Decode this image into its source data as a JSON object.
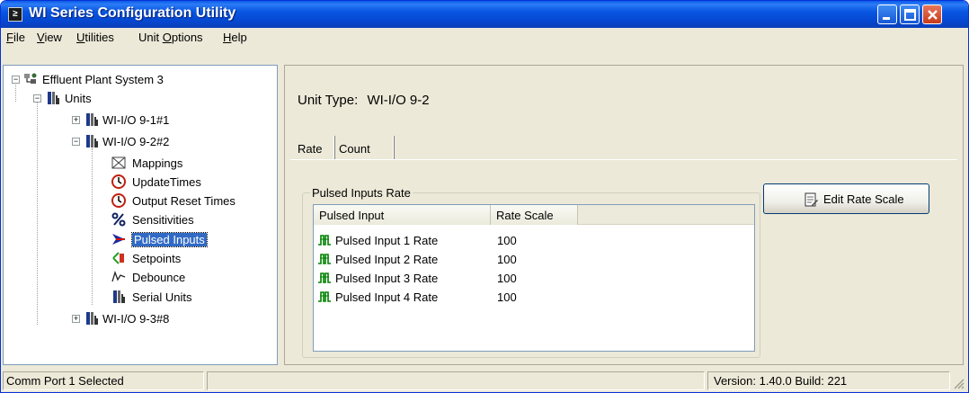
{
  "window": {
    "title": "WI Series Configuration Utility",
    "app_icon_glyph": "≥",
    "title_bar_color": "#0a5ae8",
    "close_button_color": "#d8552f"
  },
  "menu": [
    {
      "label": "File",
      "accel": "F"
    },
    {
      "label": "View",
      "accel": "V"
    },
    {
      "label": "Utilities",
      "accel": "U"
    },
    {
      "label": "Unit Options",
      "accel": "O"
    },
    {
      "label": "Help",
      "accel": "H"
    }
  ],
  "tree": {
    "root": {
      "label": "Effluent Plant System 3",
      "icon": "network-icon",
      "expanded": true
    },
    "units": {
      "label": "Units",
      "icon": "unit-icon",
      "expanded": true
    },
    "unit_1": {
      "label": "WI-I/O 9-1#1",
      "icon": "unit-icon",
      "expanded": false
    },
    "unit_2": {
      "label": "WI-I/O 9-2#2",
      "icon": "unit-icon",
      "expanded": true
    },
    "children": [
      {
        "label": "Mappings",
        "icon": "mappings-icon"
      },
      {
        "label": "UpdateTimes",
        "icon": "clock-icon"
      },
      {
        "label": "Output Reset Times",
        "icon": "clock-icon"
      },
      {
        "label": "Sensitivities",
        "icon": "percent-icon"
      },
      {
        "label": "Pulsed Inputs",
        "icon": "arrow-icon",
        "selected": true
      },
      {
        "label": "Setpoints",
        "icon": "setpoint-icon"
      },
      {
        "label": "Debounce",
        "icon": "waveform-icon"
      },
      {
        "label": "Serial Units",
        "icon": "unit-icon"
      }
    ],
    "unit_3": {
      "label": "WI-I/O 9-3#8",
      "icon": "unit-icon",
      "expanded": false
    }
  },
  "detail": {
    "unit_type_label": "Unit Type:",
    "unit_type_value": "WI-I/O 9-2",
    "tabs": [
      {
        "label": "Rate",
        "active": true
      },
      {
        "label": "Count",
        "active": false
      }
    ],
    "group_title": "Pulsed Inputs Rate",
    "columns": [
      "Pulsed Input",
      "Rate Scale"
    ],
    "rows": [
      {
        "name": "Pulsed Input 1 Rate",
        "value": "100"
      },
      {
        "name": "Pulsed Input 2 Rate",
        "value": "100"
      },
      {
        "name": "Pulsed Input 3 Rate",
        "value": "100"
      },
      {
        "name": "Pulsed Input 4 Rate",
        "value": "100"
      }
    ],
    "edit_button_label": "Edit Rate Scale",
    "row_icon_color": "#008000"
  },
  "status": {
    "left": "Comm Port 1 Selected",
    "middle": "",
    "right": "Version: 1.40.0 Build: 221"
  }
}
